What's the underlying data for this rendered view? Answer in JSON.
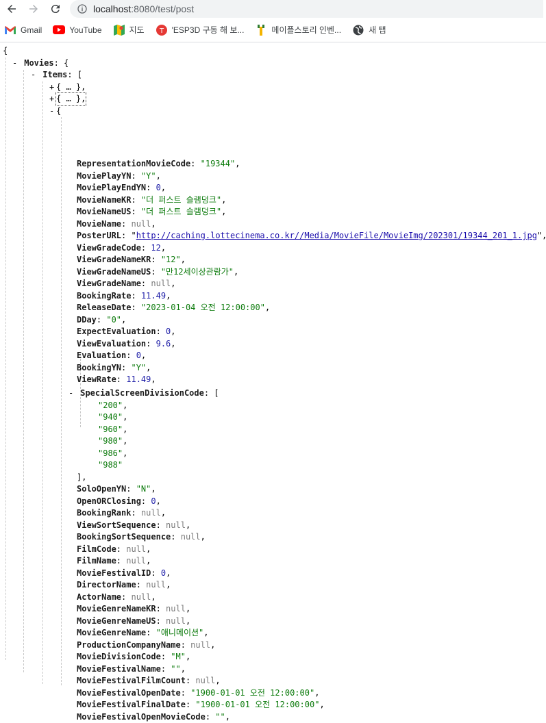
{
  "browser": {
    "url_host": "localhost",
    "url_path": ":8080/test/post",
    "bookmarks": [
      {
        "label": "Gmail",
        "icon": "gmail-icon"
      },
      {
        "label": "YouTube",
        "icon": "youtube-icon"
      },
      {
        "label": "지도",
        "icon": "maps-icon"
      },
      {
        "label": "'ESP3D 구동 해 보...",
        "icon": "esp3d-icon"
      },
      {
        "label": "메이플스토리 인벤...",
        "icon": "inven-icon"
      },
      {
        "label": "새 탭",
        "icon": "globe-icon"
      }
    ]
  },
  "json": {
    "open_brace": "{",
    "movies_key": "Movies",
    "items_key": "Items",
    "collapsed_placeholder": "{ … },",
    "item": [
      {
        "k": "RepresentationMovieCode",
        "v": "\"19344\"",
        "t": "str"
      },
      {
        "k": "MoviePlayYN",
        "v": "\"Y\"",
        "t": "str"
      },
      {
        "k": "MoviePlayEndYN",
        "v": "0",
        "t": "num"
      },
      {
        "k": "MovieNameKR",
        "v": "\"더 퍼스트 슬램덩크\"",
        "t": "str"
      },
      {
        "k": "MovieNameUS",
        "v": "\"더 퍼스트 슬램덩크\"",
        "t": "str"
      },
      {
        "k": "MovieName",
        "v": "null",
        "t": "nul"
      },
      {
        "k": "PosterURL",
        "v": "http://caching.lottecinema.co.kr//Media/MovieFile/MovieImg/202301/19344_201_1.jpg",
        "t": "lnk"
      },
      {
        "k": "ViewGradeCode",
        "v": "12",
        "t": "num"
      },
      {
        "k": "ViewGradeNameKR",
        "v": "\"12\"",
        "t": "str"
      },
      {
        "k": "ViewGradeNameUS",
        "v": "\"만12세이상관람가\"",
        "t": "str"
      },
      {
        "k": "ViewGradeName",
        "v": "null",
        "t": "nul"
      },
      {
        "k": "BookingRate",
        "v": "11.49",
        "t": "num"
      },
      {
        "k": "ReleaseDate",
        "v": "\"2023-01-04 오전 12:00:00\"",
        "t": "str"
      },
      {
        "k": "DDay",
        "v": "\"0\"",
        "t": "str"
      },
      {
        "k": "ExpectEvaluation",
        "v": "0",
        "t": "num"
      },
      {
        "k": "ViewEvaluation",
        "v": "9.6",
        "t": "num"
      },
      {
        "k": "Evaluation",
        "v": "0",
        "t": "num"
      },
      {
        "k": "BookingYN",
        "v": "\"Y\"",
        "t": "str"
      },
      {
        "k": "ViewRate",
        "v": "11.49",
        "t": "num"
      }
    ],
    "special_key": "SpecialScreenDivisionCode",
    "special_values": [
      "\"200\"",
      "\"940\"",
      "\"960\"",
      "\"980\"",
      "\"986\"",
      "\"988\""
    ],
    "item_rest": [
      {
        "k": "SoloOpenYN",
        "v": "\"N\"",
        "t": "str"
      },
      {
        "k": "OpenORClosing",
        "v": "0",
        "t": "num"
      },
      {
        "k": "BookingRank",
        "v": "null",
        "t": "nul"
      },
      {
        "k": "ViewSortSequence",
        "v": "null",
        "t": "nul"
      },
      {
        "k": "BookingSortSequence",
        "v": "null",
        "t": "nul"
      },
      {
        "k": "FilmCode",
        "v": "null",
        "t": "nul"
      },
      {
        "k": "FilmName",
        "v": "null",
        "t": "nul"
      },
      {
        "k": "MovieFestivalID",
        "v": "0",
        "t": "num"
      },
      {
        "k": "DirectorName",
        "v": "null",
        "t": "nul"
      },
      {
        "k": "ActorName",
        "v": "null",
        "t": "nul"
      },
      {
        "k": "MovieGenreNameKR",
        "v": "null",
        "t": "nul"
      },
      {
        "k": "MovieGenreNameUS",
        "v": "null",
        "t": "nul"
      },
      {
        "k": "MovieGenreName",
        "v": "\"애니메이션\"",
        "t": "str"
      },
      {
        "k": "ProductionCompanyName",
        "v": "null",
        "t": "nul"
      },
      {
        "k": "MovieDivisionCode",
        "v": "\"M\"",
        "t": "str"
      },
      {
        "k": "MovieFestivalName",
        "v": "\"\"",
        "t": "str"
      },
      {
        "k": "MovieFestivalFilmCount",
        "v": "null",
        "t": "nul"
      },
      {
        "k": "MovieFestivalOpenDate",
        "v": "\"1900-01-01 오전 12:00:00\"",
        "t": "str"
      },
      {
        "k": "MovieFestivalFinalDate",
        "v": "\"1900-01-01 오전 12:00:00\"",
        "t": "str"
      },
      {
        "k": "MovieFestivalOpenMovieCode",
        "v": "\"\"",
        "t": "str"
      }
    ]
  }
}
